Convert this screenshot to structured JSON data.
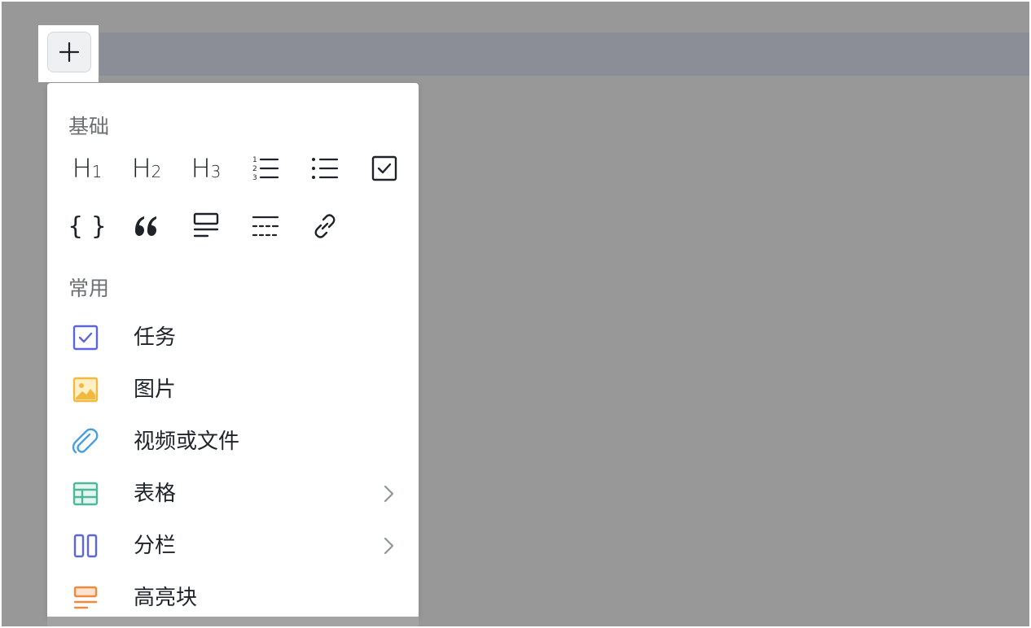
{
  "add_button": {
    "icon": "plus-icon"
  },
  "menu": {
    "sections": [
      {
        "title": "基础"
      },
      {
        "title": "常用"
      }
    ],
    "basic_items": [
      {
        "name": "heading-1",
        "icon": "heading-1-icon",
        "glyph_main": "H",
        "glyph_sub": "1"
      },
      {
        "name": "heading-2",
        "icon": "heading-2-icon",
        "glyph_main": "H",
        "glyph_sub": "2"
      },
      {
        "name": "heading-3",
        "icon": "heading-3-icon",
        "glyph_main": "H",
        "glyph_sub": "3"
      },
      {
        "name": "ordered-list",
        "icon": "ordered-list-icon"
      },
      {
        "name": "bullet-list",
        "icon": "bullet-list-icon"
      },
      {
        "name": "checklist",
        "icon": "checkbox-icon"
      },
      {
        "name": "code-block",
        "icon": "code-braces-icon",
        "glyph": "{ }"
      },
      {
        "name": "quote",
        "icon": "quote-icon"
      },
      {
        "name": "callout",
        "icon": "callout-icon"
      },
      {
        "name": "divider",
        "icon": "divider-icon"
      },
      {
        "name": "link",
        "icon": "link-icon"
      }
    ],
    "common_items": [
      {
        "label": "任务",
        "icon": "task-icon",
        "color": "#5b65dc",
        "has_submenu": false
      },
      {
        "label": "图片",
        "icon": "image-icon",
        "color": "#f3b93f",
        "has_submenu": false
      },
      {
        "label": "视频或文件",
        "icon": "paperclip-icon",
        "color": "#4a9fe0",
        "has_submenu": false
      },
      {
        "label": "表格",
        "icon": "table-icon",
        "color": "#4fb89a",
        "has_submenu": true
      },
      {
        "label": "分栏",
        "icon": "columns-icon",
        "color": "#5b65dc",
        "has_submenu": true
      },
      {
        "label": "高亮块",
        "icon": "highlight-block-icon",
        "color": "#f08a3e",
        "has_submenu": false
      }
    ]
  }
}
